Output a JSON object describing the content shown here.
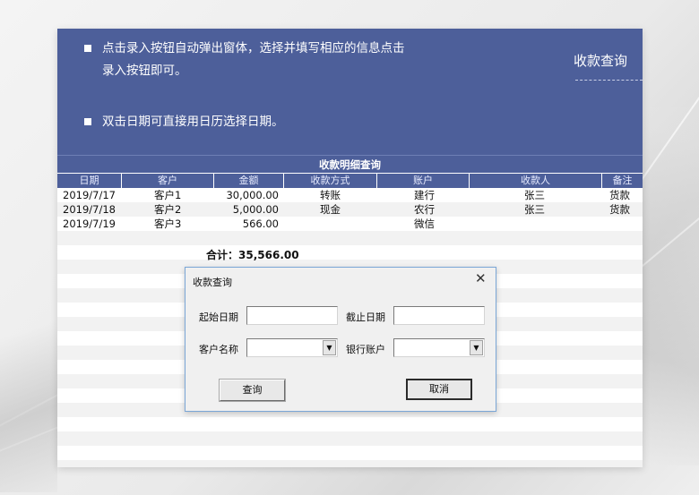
{
  "tips": [
    "点击录入按钮自动弹出窗体，选择并填写相应的信息点击录入按钮即可。",
    "双击日期可直接用日历选择日期。"
  ],
  "query_link": "收款查询",
  "table": {
    "title": "收款明细查询",
    "headers": [
      "日期",
      "客户",
      "金额",
      "收款方式",
      "账户",
      "收款人",
      "备注"
    ],
    "rows": [
      [
        "2019/7/17",
        "客户1",
        "30,000.00",
        "转账",
        "建行",
        "张三",
        "货款"
      ],
      [
        "2019/7/18",
        "客户2",
        "5,000.00",
        "现金",
        "农行",
        "张三",
        "货款"
      ],
      [
        "2019/7/19",
        "客户3",
        "566.00",
        "",
        "微信",
        "",
        ""
      ]
    ],
    "total_label": "合计：",
    "total_value": "35,566.00"
  },
  "dialog": {
    "title": "收款查询",
    "close_glyph": "✕",
    "start_date_label": "起始日期",
    "start_date_value": "",
    "end_date_label": "截止日期",
    "end_date_value": "",
    "customer_label": "客户名称",
    "customer_value": "",
    "bank_label": "银行账户",
    "bank_value": "",
    "query_button": "查询",
    "cancel_button": "取消"
  },
  "colors": {
    "banner": "#4d5f9a",
    "stripe": "#f2f2f2",
    "dialog_border": "#7aa6d6"
  }
}
